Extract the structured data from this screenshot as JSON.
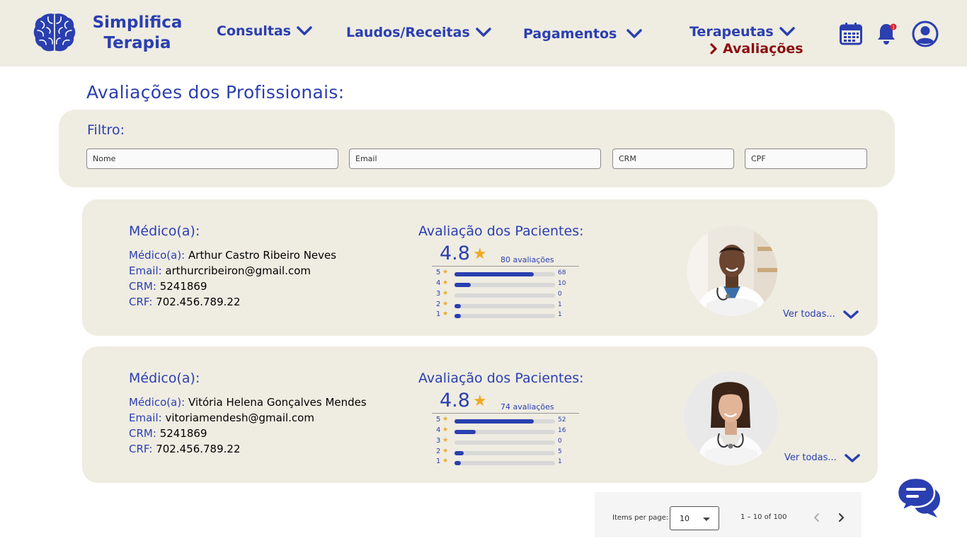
{
  "header": {
    "brand_line1": "Simplifica",
    "brand_line2": "Terapia",
    "nav": [
      {
        "label": "Consultas"
      },
      {
        "label": "Laudos/Receitas"
      },
      {
        "label": "Pagamentos"
      },
      {
        "label": "Terapeutas"
      }
    ],
    "active_sub": "Avaliações",
    "notification_count": "1",
    "icons": [
      "calendar-icon",
      "bell-icon",
      "user-icon"
    ]
  },
  "page_title": "Avaliações dos Profissionais:",
  "filter": {
    "label": "Filtro:",
    "placeholders": {
      "nome": "Nome",
      "email": "Email",
      "crm": "CRM",
      "cpf": "CPF"
    }
  },
  "doctors": [
    {
      "section_title": "Médico(a):",
      "name_label": "Médico(a):",
      "name": "Arthur Castro Ribeiro Neves",
      "email_label": "Email:",
      "email": "arthurcribeiron@gmail.com",
      "crm_label": "CRM:",
      "crm": "5241869",
      "crf_label": "CRF:",
      "crf": "702.456.789.22",
      "rating_title": "Avaliação dos Pacientes:",
      "score": "4.8",
      "reviews": "80 avaliações",
      "distribution": [
        {
          "stars": "5",
          "count": "68",
          "fraction": 0.79
        },
        {
          "stars": "4",
          "count": "10",
          "fraction": 0.16
        },
        {
          "stars": "3",
          "count": "0",
          "fraction": 0.0
        },
        {
          "stars": "2",
          "count": "1",
          "fraction": 0.06
        },
        {
          "stars": "1",
          "count": "1",
          "fraction": 0.06
        }
      ],
      "see_all": "Ver todas..."
    },
    {
      "section_title": "Médico(a):",
      "name_label": "Médico(a):",
      "name": "Vitória Helena Gonçalves Mendes",
      "email_label": "Email:",
      "email": "vitoriamendesh@gmail.com",
      "crm_label": "CRM:",
      "crm": "5241869",
      "crf_label": "CRF:",
      "crf": "702.456.789.22",
      "rating_title": "Avaliação dos Pacientes:",
      "score": "4.8",
      "reviews": "74 avaliações",
      "distribution": [
        {
          "stars": "5",
          "count": "52",
          "fraction": 0.79
        },
        {
          "stars": "4",
          "count": "16",
          "fraction": 0.21
        },
        {
          "stars": "3",
          "count": "0",
          "fraction": 0.0
        },
        {
          "stars": "2",
          "count": "5",
          "fraction": 0.09
        },
        {
          "stars": "1",
          "count": "1",
          "fraction": 0.06
        }
      ],
      "see_all": "Ver todas..."
    }
  ],
  "paginator": {
    "items_label": "Items per page:",
    "page_size": "10",
    "range": "1 – 10 of 100"
  },
  "colors": {
    "primary": "#2a3fb0",
    "header_bg": "#efece2",
    "accent_red": "#8b1010",
    "star": "#f0a81e"
  }
}
